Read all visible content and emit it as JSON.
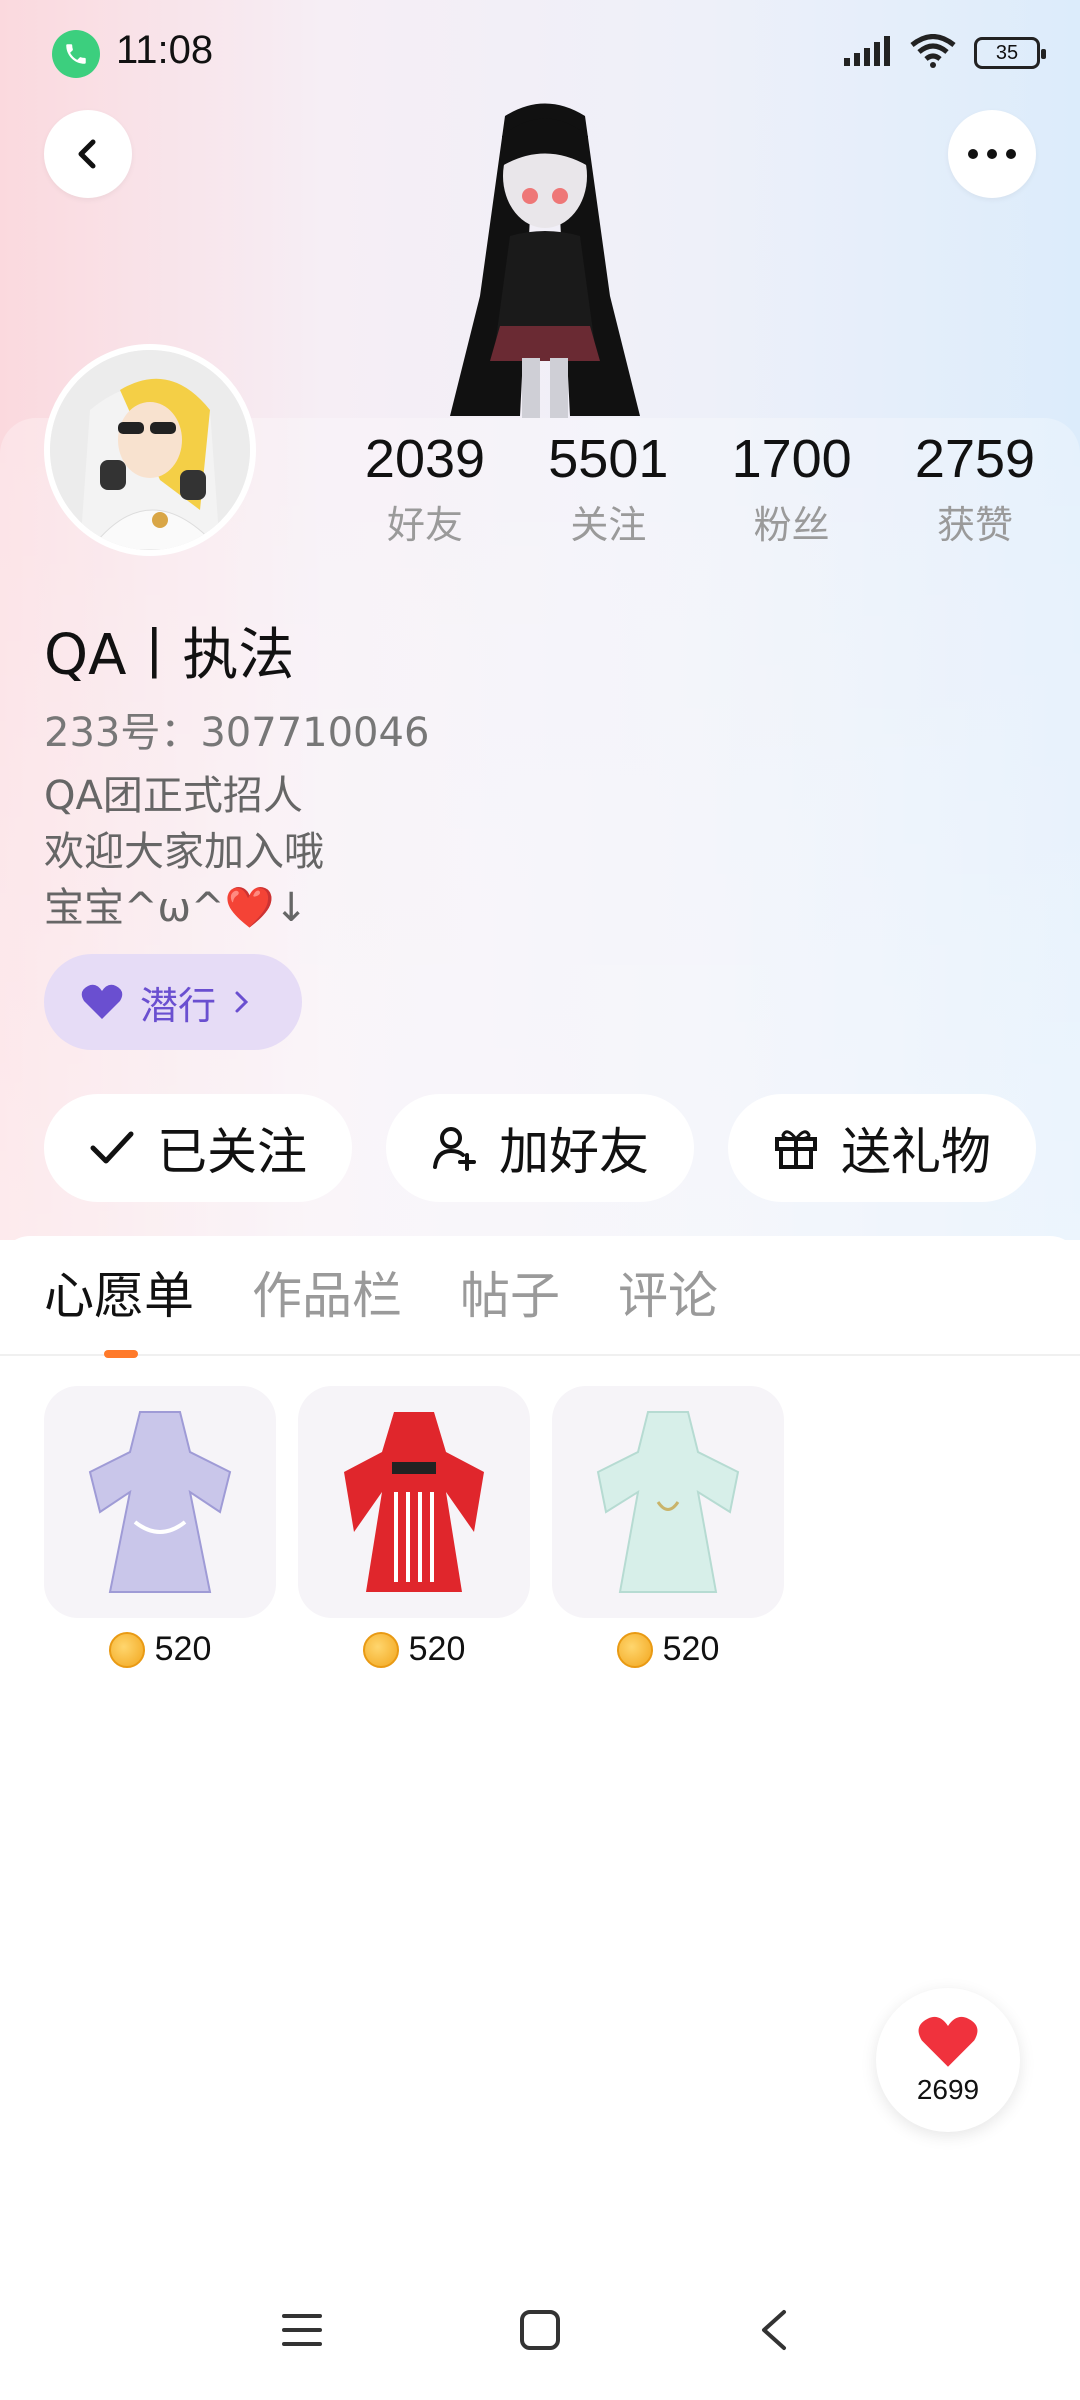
{
  "status_bar": {
    "time": "11:08",
    "battery": "35",
    "icons": [
      "phone-call-icon",
      "signal-icon",
      "wifi-icon",
      "battery-icon"
    ]
  },
  "header": {
    "back_icon": "chevron-left-icon",
    "more_icon": "more-dots-icon"
  },
  "profile": {
    "name": "QA丨执法",
    "uid_label": "233号：307710046",
    "bio_lines": [
      "QA团正式招人",
      "欢迎大家加入哦",
      "宝宝^ω^❤️↓"
    ],
    "badge_label": "潜行",
    "badge_icon": "heart-icon",
    "badge_chevron": "chevron-right-icon"
  },
  "stats": [
    {
      "value": "2039",
      "label": "好友"
    },
    {
      "value": "5501",
      "label": "关注"
    },
    {
      "value": "1700",
      "label": "粉丝"
    },
    {
      "value": "2759",
      "label": "获赞"
    }
  ],
  "actions": [
    {
      "label": "已关注",
      "icon": "check-icon"
    },
    {
      "label": "加好友",
      "icon": "add-friend-icon"
    },
    {
      "label": "送礼物",
      "icon": "gift-icon"
    }
  ],
  "tabs": [
    {
      "label": "心愿单",
      "active": true
    },
    {
      "label": "作品栏",
      "active": false
    },
    {
      "label": "帖子",
      "active": false
    },
    {
      "label": "评论",
      "active": false
    }
  ],
  "wishlist": [
    {
      "price": "520",
      "icon": "coin-icon",
      "color": "#c9c6ea"
    },
    {
      "price": "520",
      "icon": "coin-icon",
      "color": "#e0262c"
    },
    {
      "price": "520",
      "icon": "coin-icon",
      "color": "#d7efe9"
    }
  ],
  "like_fab": {
    "count": "2699",
    "icon": "heart-icon"
  },
  "colors": {
    "accent": "#ff7a2a",
    "badge_bg": "#e6dcf6",
    "badge_text": "#6a4fd0",
    "heart": "#f0323d"
  },
  "nav_bar": [
    "menu-icon",
    "home-square-icon",
    "back-triangle-icon"
  ]
}
